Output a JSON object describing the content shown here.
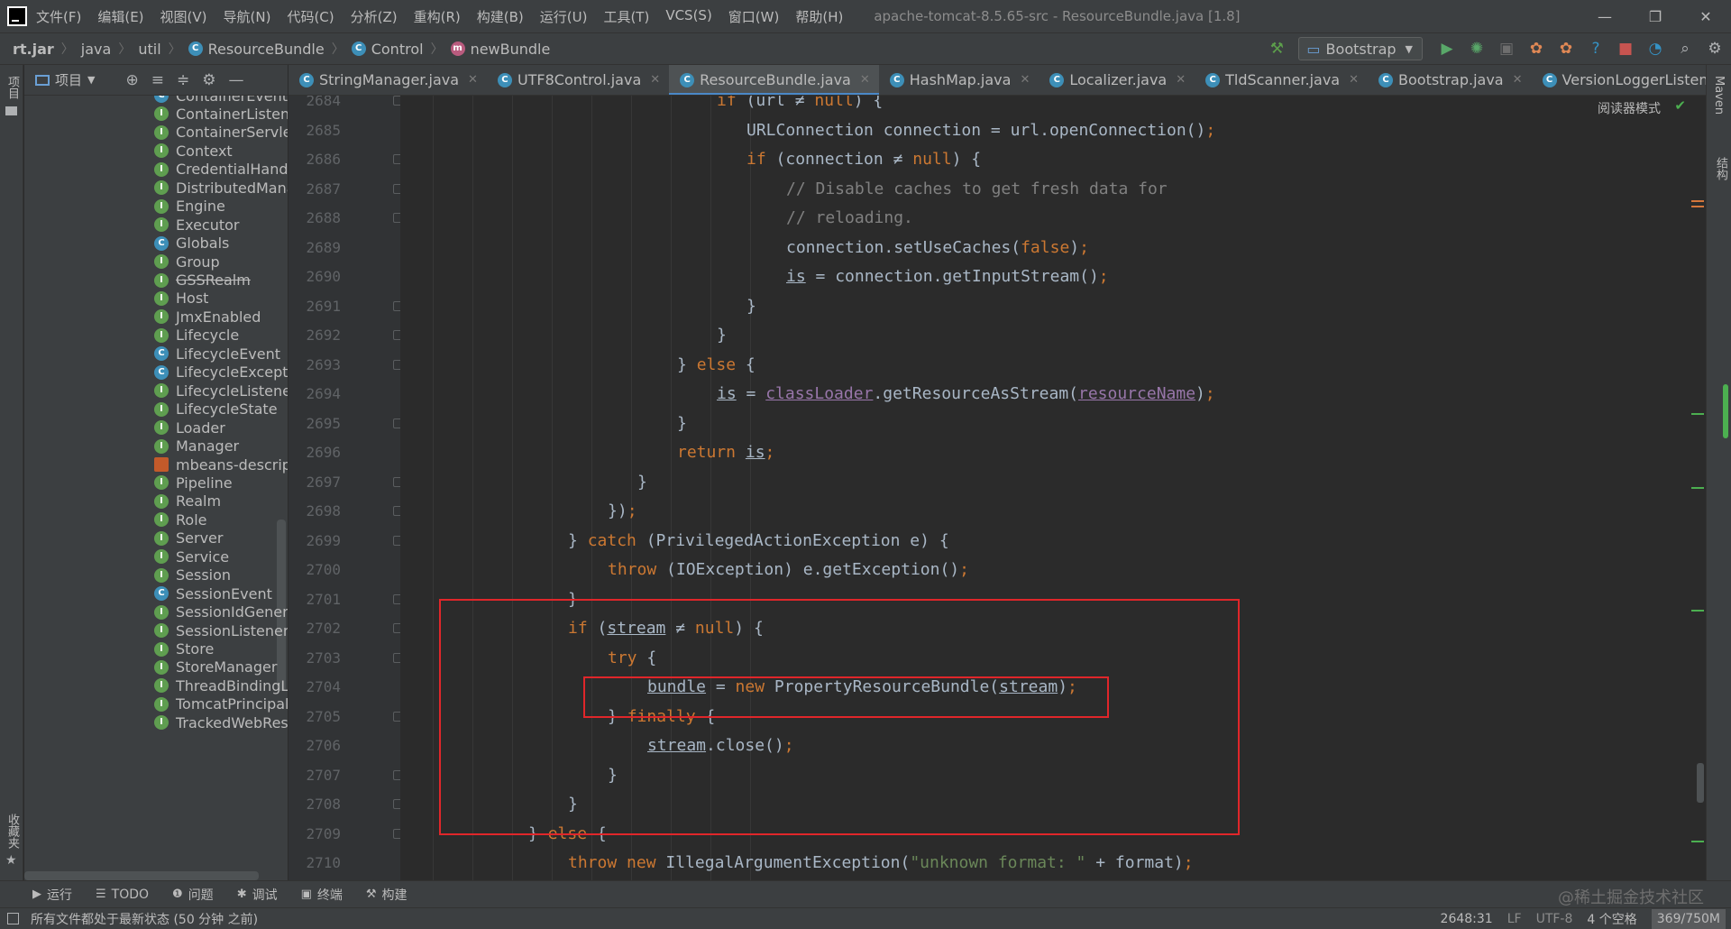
{
  "window": {
    "title": "apache-tomcat-8.5.65-src - ResourceBundle.java [1.8]",
    "menu": [
      "文件(F)",
      "编辑(E)",
      "视图(V)",
      "导航(N)",
      "代码(C)",
      "分析(Z)",
      "重构(R)",
      "构建(B)",
      "运行(U)",
      "工具(T)",
      "VCS(S)",
      "窗口(W)",
      "帮助(H)"
    ],
    "controls": {
      "minimize": "—",
      "restore": "❐",
      "close": "✕"
    }
  },
  "breadcrumb": [
    {
      "label": "rt.jar",
      "icon": ""
    },
    {
      "label": "java",
      "icon": ""
    },
    {
      "label": "util",
      "icon": ""
    },
    {
      "label": "ResourceBundle",
      "icon": "class-icon"
    },
    {
      "label": "Control",
      "icon": "class-icon"
    },
    {
      "label": "newBundle",
      "icon": "method-icon"
    }
  ],
  "run_toolbar": {
    "config": "Bootstrap"
  },
  "project_panel": {
    "title": "项目",
    "items": [
      {
        "label": "ContainerEvent",
        "kind": "c"
      },
      {
        "label": "ContainerListener",
        "kind": "i"
      },
      {
        "label": "ContainerServlet",
        "kind": "i"
      },
      {
        "label": "Context",
        "kind": "i"
      },
      {
        "label": "CredentialHandler",
        "kind": "i"
      },
      {
        "label": "DistributedManager",
        "kind": "i"
      },
      {
        "label": "Engine",
        "kind": "i"
      },
      {
        "label": "Executor",
        "kind": "i"
      },
      {
        "label": "Globals",
        "kind": "c"
      },
      {
        "label": "Group",
        "kind": "i"
      },
      {
        "label": "GSSRealm",
        "kind": "i",
        "deprecated": true
      },
      {
        "label": "Host",
        "kind": "i"
      },
      {
        "label": "JmxEnabled",
        "kind": "i"
      },
      {
        "label": "Lifecycle",
        "kind": "i"
      },
      {
        "label": "LifecycleEvent",
        "kind": "c"
      },
      {
        "label": "LifecycleException",
        "kind": "c"
      },
      {
        "label": "LifecycleListener",
        "kind": "i"
      },
      {
        "label": "LifecycleState",
        "kind": "i"
      },
      {
        "label": "Loader",
        "kind": "i"
      },
      {
        "label": "Manager",
        "kind": "i"
      },
      {
        "label": "mbeans-descriptors",
        "kind": "x"
      },
      {
        "label": "Pipeline",
        "kind": "i"
      },
      {
        "label": "Realm",
        "kind": "i"
      },
      {
        "label": "Role",
        "kind": "i"
      },
      {
        "label": "Server",
        "kind": "i"
      },
      {
        "label": "Service",
        "kind": "i"
      },
      {
        "label": "Session",
        "kind": "i"
      },
      {
        "label": "SessionEvent",
        "kind": "c"
      },
      {
        "label": "SessionIdGenerator",
        "kind": "i"
      },
      {
        "label": "SessionListener",
        "kind": "i"
      },
      {
        "label": "Store",
        "kind": "i"
      },
      {
        "label": "StoreManager",
        "kind": "i"
      },
      {
        "label": "ThreadBindingListener",
        "kind": "i"
      },
      {
        "label": "TomcatPrincipal",
        "kind": "i"
      },
      {
        "label": "TrackedWebResource",
        "kind": "i"
      }
    ]
  },
  "tabs": [
    {
      "label": "StringManager.java",
      "active": false
    },
    {
      "label": "UTF8Control.java",
      "active": false
    },
    {
      "label": "ResourceBundle.java",
      "active": true
    },
    {
      "label": "HashMap.java",
      "active": false
    },
    {
      "label": "Localizer.java",
      "active": false
    },
    {
      "label": "TldScanner.java",
      "active": false
    },
    {
      "label": "Bootstrap.java",
      "active": false
    },
    {
      "label": "VersionLoggerListener.java",
      "active": false
    }
  ],
  "editor": {
    "reader_mode": "阅读器模式",
    "line_numbers": [
      "2684",
      "2685",
      "2686",
      "2687",
      "2688",
      "2689",
      "2690",
      "2691",
      "2692",
      "2693",
      "2694",
      "2695",
      "2696",
      "2697",
      "2698",
      "2699",
      "2700",
      "2701",
      "2702",
      "2703",
      "2704",
      "2705",
      "2706",
      "2707",
      "2708",
      "2709",
      "2710"
    ],
    "lines": [
      [
        [
          "kw",
          "if"
        ],
        [
          "t",
          " (url ≠ "
        ],
        [
          "kw",
          "null"
        ],
        [
          "t",
          ") {"
        ]
      ],
      [
        [
          "t",
          "URLConnection connection = url.openConnection()"
        ],
        [
          "kw",
          ";"
        ]
      ],
      [
        [
          "kw",
          "if"
        ],
        [
          "t",
          " (connection ≠ "
        ],
        [
          "kw",
          "null"
        ],
        [
          "t",
          ") {"
        ]
      ],
      [
        [
          "cm",
          "// Disable caches to get fresh data for"
        ]
      ],
      [
        [
          "cm",
          "// reloading."
        ]
      ],
      [
        [
          "t",
          "connection.setUseCaches("
        ],
        [
          "kw",
          "false"
        ],
        [
          "t",
          ")"
        ],
        [
          "kw",
          ";"
        ]
      ],
      [
        [
          "ul",
          "is"
        ],
        [
          "t",
          " = connection.getInputStream()"
        ],
        [
          "kw",
          ";"
        ]
      ],
      [
        [
          "t",
          "}"
        ]
      ],
      [
        [
          "t",
          "}"
        ]
      ],
      [
        [
          "t",
          "} "
        ],
        [
          "kw",
          "else"
        ],
        [
          "t",
          " {"
        ]
      ],
      [
        [
          "ul",
          "is"
        ],
        [
          "t",
          " = "
        ],
        [
          "fld",
          "classLoader"
        ],
        [
          "t",
          ".getResourceAsStream("
        ],
        [
          "fld",
          "resourceName"
        ],
        [
          "t",
          ")"
        ],
        [
          "kw",
          ";"
        ]
      ],
      [
        [
          "t",
          "}"
        ]
      ],
      [
        [
          "kw",
          "return "
        ],
        [
          "ul",
          "is"
        ],
        [
          "kw",
          ";"
        ]
      ],
      [
        [
          "t",
          "}"
        ]
      ],
      [
        [
          "t",
          "})"
        ],
        [
          "kw",
          ";"
        ]
      ],
      [
        [
          "t",
          "} "
        ],
        [
          "kw",
          "catch"
        ],
        [
          "t",
          " (PrivilegedActionException e) {"
        ]
      ],
      [
        [
          "kw",
          "throw"
        ],
        [
          "t",
          " (IOException) e.getException()"
        ],
        [
          "kw",
          ";"
        ]
      ],
      [
        [
          "t",
          "}"
        ]
      ],
      [
        [
          "kw",
          "if"
        ],
        [
          "t",
          " ("
        ],
        [
          "ul",
          "stream"
        ],
        [
          "t",
          " ≠ "
        ],
        [
          "kw",
          "null"
        ],
        [
          "t",
          ") {"
        ]
      ],
      [
        [
          "kw",
          "try"
        ],
        [
          "t",
          " {"
        ]
      ],
      [
        [
          "ul",
          "bundle"
        ],
        [
          "t",
          " = "
        ],
        [
          "kw",
          "new"
        ],
        [
          "t",
          " PropertyResourceBundle("
        ],
        [
          "ul",
          "stream"
        ],
        [
          "t",
          ")"
        ],
        [
          "kw",
          ";"
        ]
      ],
      [
        [
          "t",
          "} "
        ],
        [
          "kw",
          "finally"
        ],
        [
          "t",
          " {"
        ]
      ],
      [
        [
          "ul",
          "stream"
        ],
        [
          "t",
          ".close()"
        ],
        [
          "kw",
          ";"
        ]
      ],
      [
        [
          "t",
          "}"
        ]
      ],
      [
        [
          "t",
          "}"
        ]
      ],
      [
        [
          "t",
          "} "
        ],
        [
          "kw",
          "else"
        ],
        [
          "t",
          " {"
        ]
      ],
      [
        [
          "kw",
          "throw new"
        ],
        [
          "t",
          " IllegalArgumentException("
        ],
        [
          "st",
          "\"unknown format: \""
        ],
        [
          "t",
          " + format)"
        ],
        [
          "kw",
          ";"
        ]
      ]
    ]
  },
  "left_strip": {
    "project": "项目",
    "favorites": "收藏夹"
  },
  "right_strip": {
    "maven": "Maven",
    "structure": "结构"
  },
  "bottom_tools": [
    {
      "label": "运行",
      "icon": "▶"
    },
    {
      "label": "TODO",
      "icon": "☰"
    },
    {
      "label": "问题",
      "icon": "❶"
    },
    {
      "label": "调试",
      "icon": "✱"
    },
    {
      "label": "终端",
      "icon": "▣"
    },
    {
      "label": "构建",
      "icon": "⚒"
    }
  ],
  "watermark": "@稀土掘金技术社区",
  "status": {
    "message": "所有文件都处于最新状态 (50 分钟 之前)",
    "position": "2648:31",
    "line_sep": "LF",
    "encoding": "UTF-8",
    "indent": "4 个空格",
    "memory": "369/750M"
  },
  "colors": {
    "keyword": "#cc7832",
    "comment": "#808080",
    "string": "#6a8759",
    "field": "#9876aa",
    "highlight_box": "#e0262a",
    "accent": "#4a88c7"
  }
}
